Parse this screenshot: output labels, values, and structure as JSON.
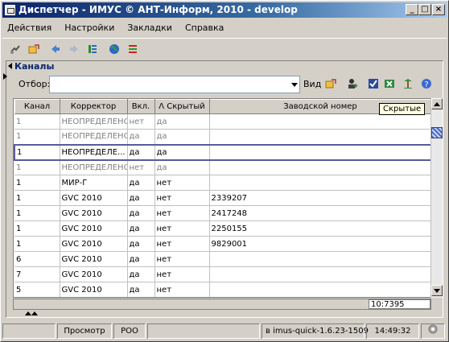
{
  "window": {
    "title": "Диспетчер - ИМУС © АНТ-Информ, 2010 - develop",
    "buttons": {
      "minimize": "_",
      "maximize": "□",
      "close": "×"
    }
  },
  "menu": [
    "Действия",
    "Настройки",
    "Закладки",
    "Справка"
  ],
  "toolbar_icons": [
    "connect-icon",
    "refresh-icon",
    "back-icon",
    "forward-icon",
    "columns-icon",
    "globe-icon",
    "flag-icon"
  ],
  "panel": {
    "title": "Каналы",
    "filter_label": "Отбор:",
    "filter_value": "",
    "view_label": "Вид",
    "view_icons": [
      "refresh-icon",
      "user-add-icon",
      "checkbox-icon",
      "excel-icon",
      "tree-icon",
      "help-icon"
    ]
  },
  "grid": {
    "columns": [
      "Канал",
      "Корректор",
      "Вкл.",
      "Λ Скрытый",
      "Заводской номер"
    ],
    "rows": [
      {
        "channel": "1",
        "corrector": "НЕОПРЕДЕЛЕНО",
        "enabled": "нет",
        "hidden": "да",
        "serial": "",
        "style": "grey"
      },
      {
        "channel": "1",
        "corrector": "НЕОПРЕДЕЛЕНО",
        "enabled": "да",
        "hidden": "да",
        "serial": "",
        "style": "grey"
      },
      {
        "channel": "1",
        "corrector": "НЕОПРЕДЕЛЕ...",
        "enabled": "да",
        "hidden": "да",
        "serial": "",
        "style": "sel"
      },
      {
        "channel": "1",
        "corrector": "НЕОПРЕДЕЛЕНО",
        "enabled": "нет",
        "hidden": "да",
        "serial": "",
        "style": "grey"
      },
      {
        "channel": "1",
        "corrector": "МИР-Г",
        "enabled": "да",
        "hidden": "нет",
        "serial": "",
        "style": ""
      },
      {
        "channel": "1",
        "corrector": "GVC 2010",
        "enabled": "да",
        "hidden": "нет",
        "serial": "2339207",
        "style": ""
      },
      {
        "channel": "1",
        "corrector": "GVC 2010",
        "enabled": "да",
        "hidden": "нет",
        "serial": "2417248",
        "style": ""
      },
      {
        "channel": "1",
        "corrector": "GVC 2010",
        "enabled": "да",
        "hidden": "нет",
        "serial": "2250155",
        "style": ""
      },
      {
        "channel": "1",
        "corrector": "GVC 2010",
        "enabled": "да",
        "hidden": "нет",
        "serial": "9829001",
        "style": ""
      },
      {
        "channel": "6",
        "corrector": "GVC 2010",
        "enabled": "да",
        "hidden": "нет",
        "serial": "",
        "style": ""
      },
      {
        "channel": "7",
        "corrector": "GVC 2010",
        "enabled": "да",
        "hidden": "нет",
        "serial": "",
        "style": ""
      },
      {
        "channel": "5",
        "corrector": "GVC 2010",
        "enabled": "да",
        "hidden": "нет",
        "serial": "",
        "style": ""
      }
    ],
    "tooltip": "Скрытые",
    "coord": "10:7395"
  },
  "status": {
    "view": "Просмотр",
    "mode": "РОО",
    "version": "в imus-quick-1.6.23-1509",
    "time": "14:49:32"
  }
}
